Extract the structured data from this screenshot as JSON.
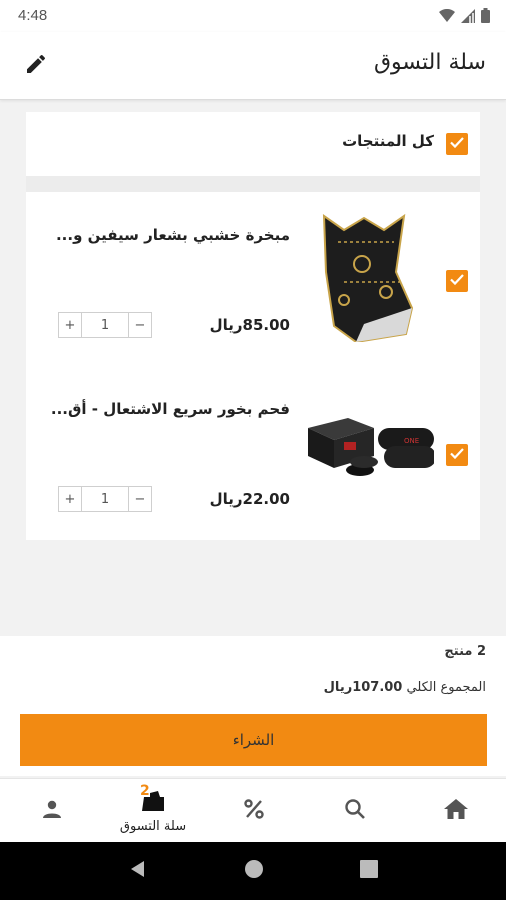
{
  "status_bar": {
    "time": "4:48",
    "icons": [
      "wifi-icon",
      "signal-icon",
      "battery-icon"
    ]
  },
  "app_bar": {
    "title": "سلة التسوق",
    "edit_icon": "pencil-icon"
  },
  "select_all": {
    "label": "كل المنتجات",
    "checked": true
  },
  "items": [
    {
      "name": "مبخرة خشبي بشعار سيفين و...",
      "price": "85.00ريال",
      "quantity": "1",
      "checked": true,
      "thumbnail": "incense-burner-image"
    },
    {
      "name": "فحم بخور سريع الاشتعال - أق...",
      "price": "22.00ريال",
      "quantity": "1",
      "checked": true,
      "thumbnail": "charcoal-box-image"
    }
  ],
  "stepper": {
    "minus": "−",
    "plus": "+"
  },
  "summary": {
    "count": "2 منتج",
    "total_label": "المجموع الكلي",
    "total_value": "107.00ريال",
    "buy_label": "الشراء"
  },
  "bottom_nav": {
    "items": [
      {
        "icon": "person-icon",
        "label": ""
      },
      {
        "icon": "cart-icon",
        "label": "سلة التسوق",
        "badge": "2"
      },
      {
        "icon": "percent-icon",
        "label": ""
      },
      {
        "icon": "search-icon",
        "label": ""
      },
      {
        "icon": "home-icon",
        "label": ""
      }
    ]
  },
  "colors": {
    "accent": "#f28a12",
    "background": "#f2f2f2",
    "card": "#ffffff"
  }
}
